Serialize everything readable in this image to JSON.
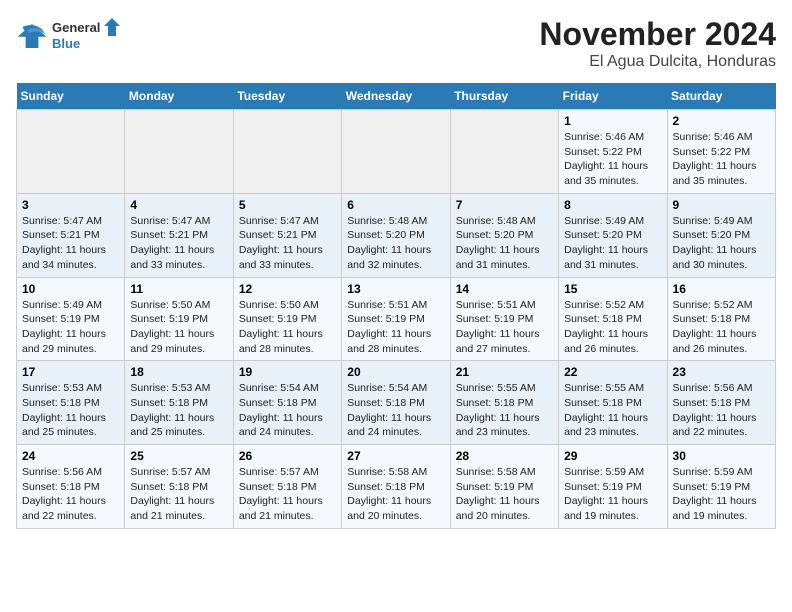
{
  "logo": {
    "general": "General",
    "blue": "Blue"
  },
  "title": "November 2024",
  "subtitle": "El Agua Dulcita, Honduras",
  "days_of_week": [
    "Sunday",
    "Monday",
    "Tuesday",
    "Wednesday",
    "Thursday",
    "Friday",
    "Saturday"
  ],
  "weeks": [
    [
      {
        "day": "",
        "info": ""
      },
      {
        "day": "",
        "info": ""
      },
      {
        "day": "",
        "info": ""
      },
      {
        "day": "",
        "info": ""
      },
      {
        "day": "",
        "info": ""
      },
      {
        "day": "1",
        "info": "Sunrise: 5:46 AM\nSunset: 5:22 PM\nDaylight: 11 hours and 35 minutes."
      },
      {
        "day": "2",
        "info": "Sunrise: 5:46 AM\nSunset: 5:22 PM\nDaylight: 11 hours and 35 minutes."
      }
    ],
    [
      {
        "day": "3",
        "info": "Sunrise: 5:47 AM\nSunset: 5:21 PM\nDaylight: 11 hours and 34 minutes."
      },
      {
        "day": "4",
        "info": "Sunrise: 5:47 AM\nSunset: 5:21 PM\nDaylight: 11 hours and 33 minutes."
      },
      {
        "day": "5",
        "info": "Sunrise: 5:47 AM\nSunset: 5:21 PM\nDaylight: 11 hours and 33 minutes."
      },
      {
        "day": "6",
        "info": "Sunrise: 5:48 AM\nSunset: 5:20 PM\nDaylight: 11 hours and 32 minutes."
      },
      {
        "day": "7",
        "info": "Sunrise: 5:48 AM\nSunset: 5:20 PM\nDaylight: 11 hours and 31 minutes."
      },
      {
        "day": "8",
        "info": "Sunrise: 5:49 AM\nSunset: 5:20 PM\nDaylight: 11 hours and 31 minutes."
      },
      {
        "day": "9",
        "info": "Sunrise: 5:49 AM\nSunset: 5:20 PM\nDaylight: 11 hours and 30 minutes."
      }
    ],
    [
      {
        "day": "10",
        "info": "Sunrise: 5:49 AM\nSunset: 5:19 PM\nDaylight: 11 hours and 29 minutes."
      },
      {
        "day": "11",
        "info": "Sunrise: 5:50 AM\nSunset: 5:19 PM\nDaylight: 11 hours and 29 minutes."
      },
      {
        "day": "12",
        "info": "Sunrise: 5:50 AM\nSunset: 5:19 PM\nDaylight: 11 hours and 28 minutes."
      },
      {
        "day": "13",
        "info": "Sunrise: 5:51 AM\nSunset: 5:19 PM\nDaylight: 11 hours and 28 minutes."
      },
      {
        "day": "14",
        "info": "Sunrise: 5:51 AM\nSunset: 5:19 PM\nDaylight: 11 hours and 27 minutes."
      },
      {
        "day": "15",
        "info": "Sunrise: 5:52 AM\nSunset: 5:18 PM\nDaylight: 11 hours and 26 minutes."
      },
      {
        "day": "16",
        "info": "Sunrise: 5:52 AM\nSunset: 5:18 PM\nDaylight: 11 hours and 26 minutes."
      }
    ],
    [
      {
        "day": "17",
        "info": "Sunrise: 5:53 AM\nSunset: 5:18 PM\nDaylight: 11 hours and 25 minutes."
      },
      {
        "day": "18",
        "info": "Sunrise: 5:53 AM\nSunset: 5:18 PM\nDaylight: 11 hours and 25 minutes."
      },
      {
        "day": "19",
        "info": "Sunrise: 5:54 AM\nSunset: 5:18 PM\nDaylight: 11 hours and 24 minutes."
      },
      {
        "day": "20",
        "info": "Sunrise: 5:54 AM\nSunset: 5:18 PM\nDaylight: 11 hours and 24 minutes."
      },
      {
        "day": "21",
        "info": "Sunrise: 5:55 AM\nSunset: 5:18 PM\nDaylight: 11 hours and 23 minutes."
      },
      {
        "day": "22",
        "info": "Sunrise: 5:55 AM\nSunset: 5:18 PM\nDaylight: 11 hours and 23 minutes."
      },
      {
        "day": "23",
        "info": "Sunrise: 5:56 AM\nSunset: 5:18 PM\nDaylight: 11 hours and 22 minutes."
      }
    ],
    [
      {
        "day": "24",
        "info": "Sunrise: 5:56 AM\nSunset: 5:18 PM\nDaylight: 11 hours and 22 minutes."
      },
      {
        "day": "25",
        "info": "Sunrise: 5:57 AM\nSunset: 5:18 PM\nDaylight: 11 hours and 21 minutes."
      },
      {
        "day": "26",
        "info": "Sunrise: 5:57 AM\nSunset: 5:18 PM\nDaylight: 11 hours and 21 minutes."
      },
      {
        "day": "27",
        "info": "Sunrise: 5:58 AM\nSunset: 5:18 PM\nDaylight: 11 hours and 20 minutes."
      },
      {
        "day": "28",
        "info": "Sunrise: 5:58 AM\nSunset: 5:19 PM\nDaylight: 11 hours and 20 minutes."
      },
      {
        "day": "29",
        "info": "Sunrise: 5:59 AM\nSunset: 5:19 PM\nDaylight: 11 hours and 19 minutes."
      },
      {
        "day": "30",
        "info": "Sunrise: 5:59 AM\nSunset: 5:19 PM\nDaylight: 11 hours and 19 minutes."
      }
    ]
  ]
}
